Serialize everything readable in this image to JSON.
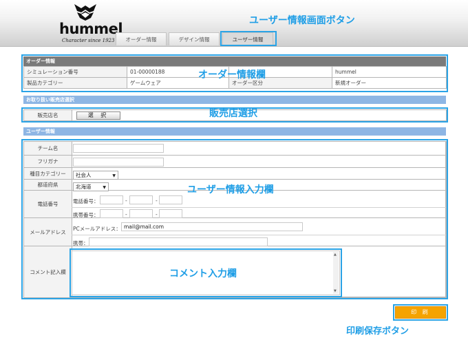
{
  "brand": {
    "name": "hummel",
    "tagline": "Character since 1923"
  },
  "tabs": [
    {
      "label": "オーダー情報"
    },
    {
      "label": "デザイン情報"
    },
    {
      "label": "ユーザー情報"
    }
  ],
  "callouts": {
    "user_tab": "ユーザー情報画面ボタン",
    "order": "オーダー情報欄",
    "store": "販売店選択",
    "user_input": "ユーザー情報入力欄",
    "comment": "コメント入力欄",
    "print": "印刷保存ボタン"
  },
  "order": {
    "title": "オーダー情報",
    "rows": [
      [
        "シミュレーション番号",
        "01-00000188",
        "",
        "hummel"
      ],
      [
        "製品カテゴリー",
        "ゲームウェア",
        "オーダー区分",
        "新規オーダー"
      ]
    ]
  },
  "store": {
    "title": "お取り扱い販売店選択",
    "label": "販売店名",
    "button": "選 択"
  },
  "user": {
    "title": "ユーザー情報",
    "team_label": "チーム名",
    "team_value": "",
    "kana_label": "フリガナ",
    "kana_value": "",
    "category_label": "種目カテゴリー",
    "category_value": "社会人",
    "pref_label": "都道府県",
    "pref_value": "北海道",
    "phone_label": "電話番号",
    "tel_label": "電話番号：",
    "mobile_label": "携帯番号：",
    "dash": "-",
    "mail_label": "メールアドレス",
    "pc_mail_label": "PCメールアドレス：",
    "pc_mail_value": "mail@mail.com",
    "mobile_mail_label": "携帯：",
    "comment_label": "コメント記入欄"
  },
  "print_button": "印 刷"
}
